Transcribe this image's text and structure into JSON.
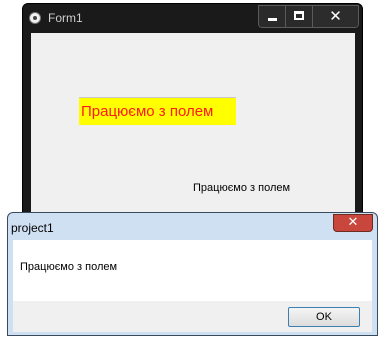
{
  "form": {
    "title": "Form1",
    "edit_value": "Працюємо з полем",
    "label_text": "Працюємо з полем",
    "edit_background": "#ffff00",
    "edit_text_color": "#ff1a1a",
    "close_glyph": "✕"
  },
  "message_box": {
    "title": "project1",
    "message": "Працюємо з полем",
    "ok_label": "OK",
    "close_glyph": "✕"
  }
}
